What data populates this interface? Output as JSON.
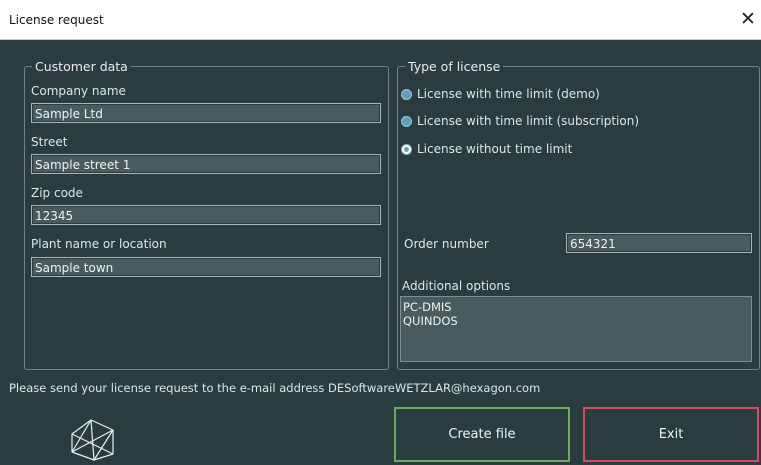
{
  "window": {
    "title": "License request",
    "close_icon": "close-icon"
  },
  "customer": {
    "legend": "Customer data",
    "company_label": "Company name",
    "company_value": "Sample Ltd",
    "street_label": "Street",
    "street_value": "Sample street 1",
    "zip_label": "Zip code",
    "zip_value": "12345",
    "plant_label": "Plant name or location",
    "plant_value": "Sample town"
  },
  "license": {
    "legend": "Type of license",
    "options": [
      {
        "label": "License with time limit (demo)",
        "selected": false
      },
      {
        "label": "License with time limit (subscription)",
        "selected": false
      },
      {
        "label": "License without time limit",
        "selected": true
      }
    ],
    "order_label": "Order number",
    "order_value": "654321",
    "additional_label": "Additional options",
    "additional_items": [
      "PC-DMIS",
      "QUINDOS"
    ]
  },
  "footer": {
    "notice": "Please send your license request to the e-mail address DESoftwareWETZLAR@hexagon.com",
    "create_label": "Create file",
    "exit_label": "Exit",
    "logo_icon": "hexagon-logo-icon"
  },
  "colors": {
    "background": "#2a3c40",
    "create_border": "#6cab5b",
    "exit_border": "#d94b5c",
    "radio_accent": "#5fa1b6"
  }
}
